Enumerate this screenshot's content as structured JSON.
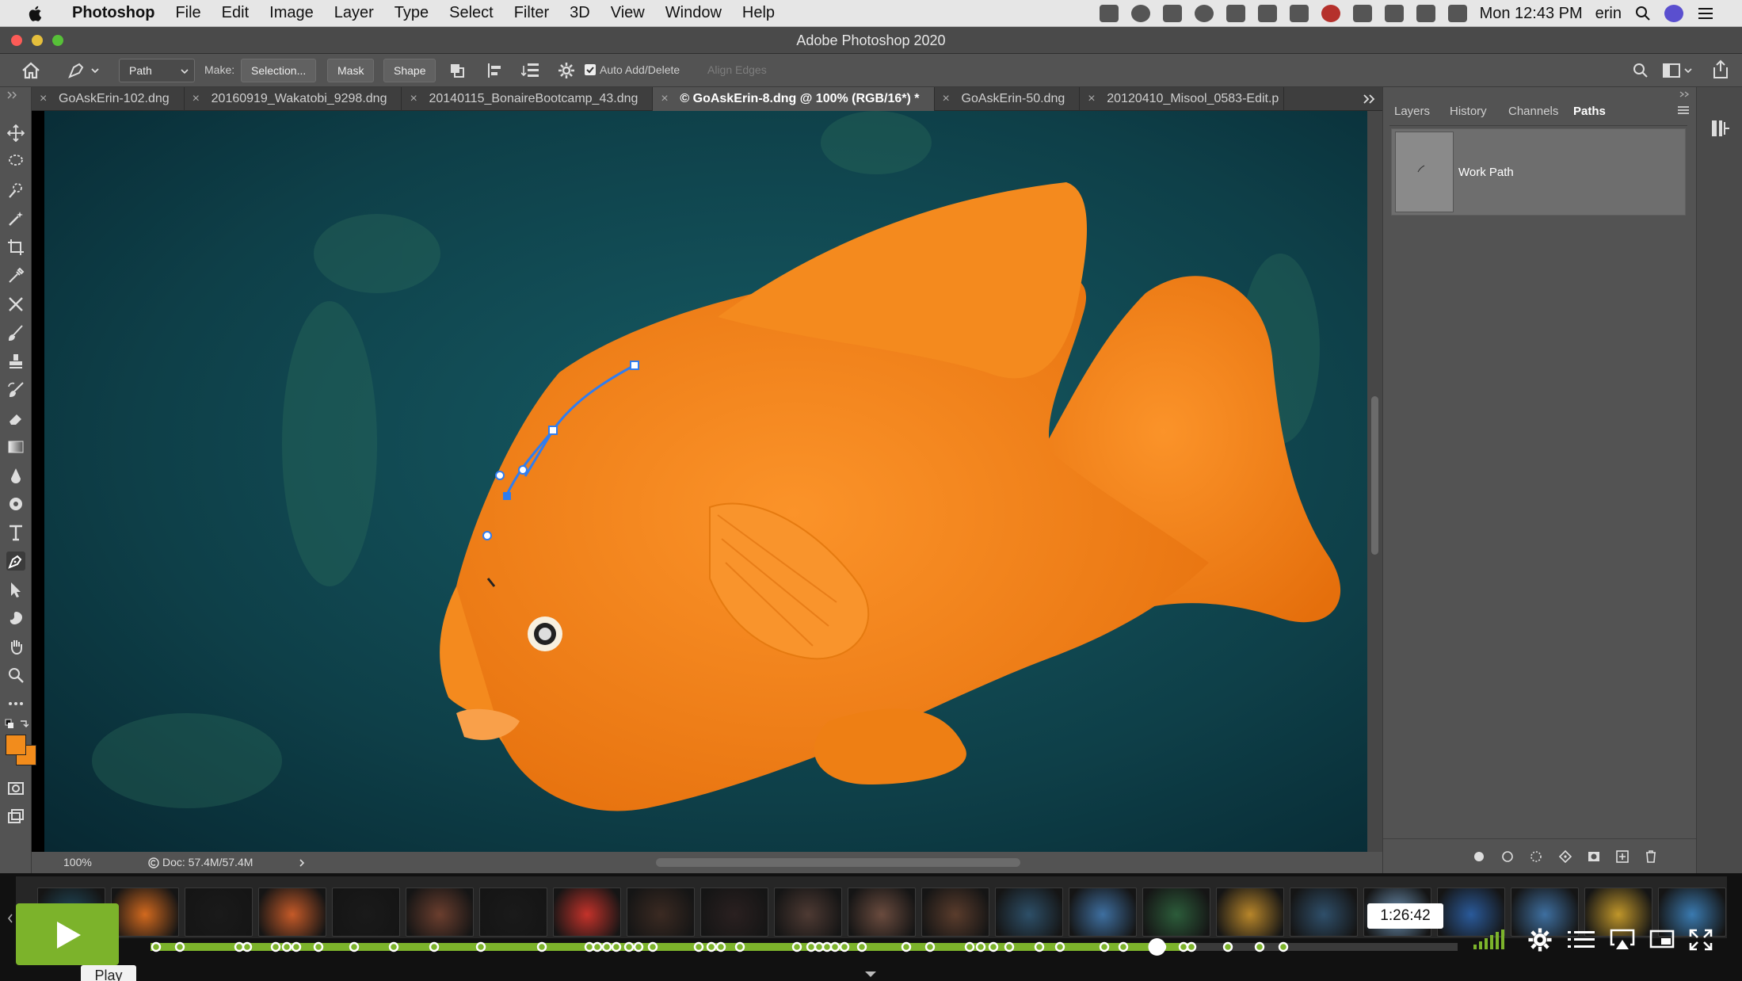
{
  "menubar": {
    "app_name": "Photoshop",
    "items": [
      "File",
      "Edit",
      "Image",
      "Layer",
      "Type",
      "Select",
      "Filter",
      "3D",
      "View",
      "Window",
      "Help"
    ],
    "clock": "Mon 12:43 PM",
    "user": "erin"
  },
  "window": {
    "title": "Adobe Photoshop 2020"
  },
  "options": {
    "mode": "Path",
    "make_label": "Make:",
    "selection_button": "Selection...",
    "mask_button": "Mask",
    "shape_button": "Shape",
    "auto_add_delete": "Auto Add/Delete",
    "align_edges": "Align Edges"
  },
  "tabs": [
    {
      "label": "GoAskErin-102.dng",
      "active": false
    },
    {
      "label": "20160919_Wakatobi_9298.dng",
      "active": false
    },
    {
      "label": "20140115_BonaireBootcamp_43.dng",
      "active": false
    },
    {
      "label": "© GoAskErin-8.dng @ 100% (RGB/16*) *",
      "active": true
    },
    {
      "label": "GoAskErin-50.dng",
      "active": false
    },
    {
      "label": "20120410_Misool_0583-Edit.p",
      "active": false
    }
  ],
  "status": {
    "zoom": "100%",
    "doc_info": "Doc: 57.4M/57.4M"
  },
  "panel": {
    "tabs": [
      "Layers",
      "History",
      "Channels",
      "Paths"
    ],
    "active_tab": "Paths",
    "path_item": "Work Path"
  },
  "player": {
    "time_tooltip": "1:26:42",
    "play_tooltip": "Play",
    "progress_fraction": 0.77,
    "accent": "#7cb32b"
  },
  "colors": {
    "foreground": "#f28c1c",
    "background": "#f28c1c",
    "fish": "#f6891d",
    "water": "#0f3c46"
  }
}
